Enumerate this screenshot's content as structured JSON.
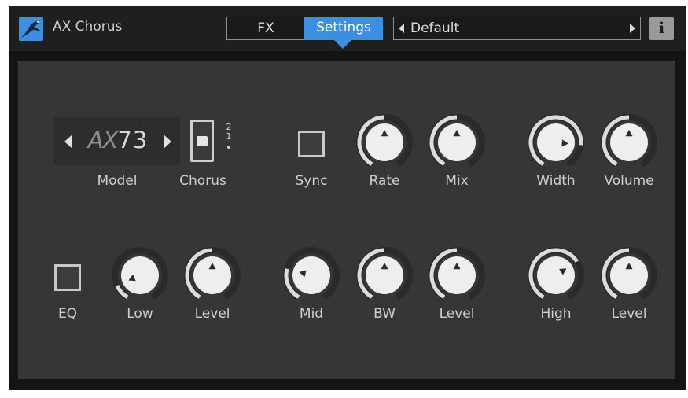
{
  "app": {
    "title": "AX Chorus",
    "logo": "bird-logo-icon",
    "accent": "#3d8ede"
  },
  "tabs": [
    {
      "label": "FX",
      "active": false
    },
    {
      "label": "Settings",
      "active": true
    }
  ],
  "preset": {
    "name": "Default",
    "prev_icon": "triangle-left-icon",
    "next_icon": "triangle-right-icon"
  },
  "info_button": {
    "label": "i"
  },
  "row1": {
    "model": {
      "label": "Model",
      "value_dim": "AX",
      "value_bright": "73"
    },
    "chorus": {
      "label": "Chorus",
      "positions": [
        "2",
        "1"
      ],
      "selected": "1"
    },
    "sync": {
      "label": "Sync",
      "checked": false
    },
    "knobs": [
      {
        "id": "rate",
        "label": "Rate",
        "value": 0.5
      },
      {
        "id": "mix",
        "label": "Mix",
        "value": 0.5
      },
      {
        "id": "width",
        "label": "Width",
        "value": 0.82
      },
      {
        "id": "volume",
        "label": "Volume",
        "value": 0.5
      }
    ]
  },
  "row2": {
    "eq": {
      "label": "EQ",
      "checked": false
    },
    "knobs": [
      {
        "id": "low",
        "label": "Low",
        "value": 0.12
      },
      {
        "id": "level1",
        "label": "Level",
        "value": 0.5
      },
      {
        "id": "mid",
        "label": "Mid",
        "value": 0.25
      },
      {
        "id": "bw",
        "label": "BW",
        "value": 0.5
      },
      {
        "id": "level2",
        "label": "Level",
        "value": 0.5
      },
      {
        "id": "high",
        "label": "High",
        "value": 0.69
      },
      {
        "id": "level3",
        "label": "Level",
        "value": 0.5
      }
    ]
  }
}
